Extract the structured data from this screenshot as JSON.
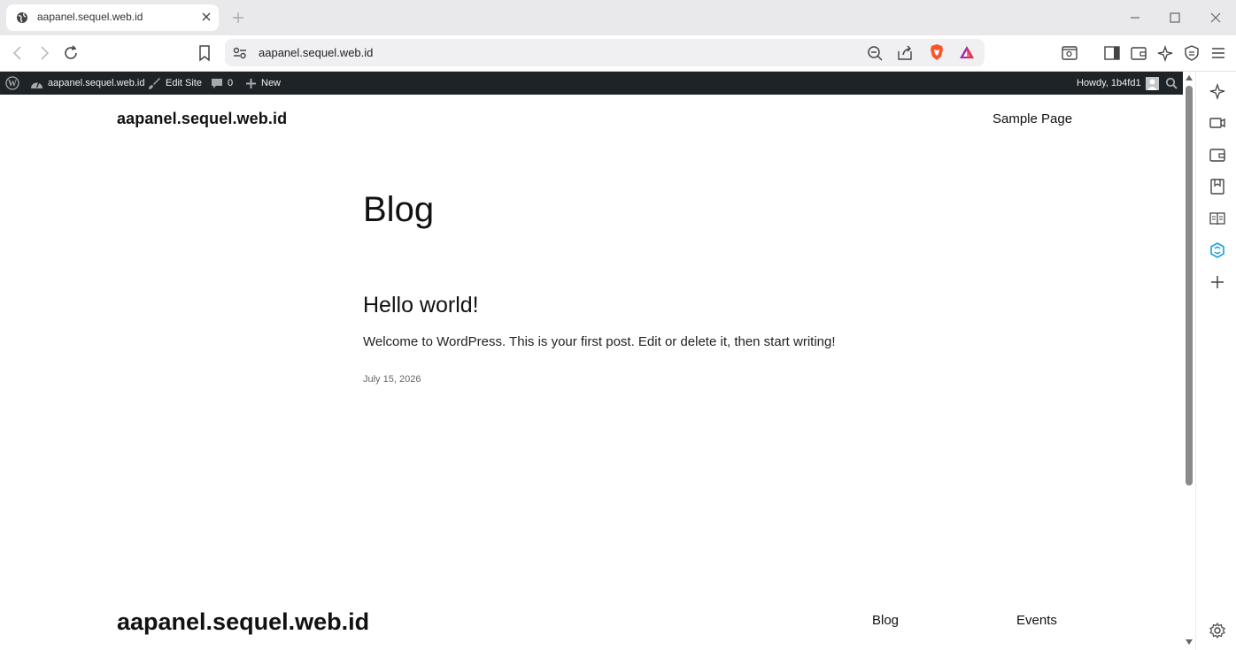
{
  "browser": {
    "tab_title": "aapanel.sequel.web.id",
    "url": "aapanel.sequel.web.id"
  },
  "admin_bar": {
    "site_name": "aapanel.sequel.web.id",
    "edit_site": "Edit Site",
    "comments_count": "0",
    "new_label": "New",
    "howdy": "Howdy, 1b4fd1"
  },
  "site": {
    "title": "aapanel.sequel.web.id",
    "nav_sample_page": "Sample Page"
  },
  "main": {
    "heading": "Blog",
    "post": {
      "title": "Hello world!",
      "excerpt": "Welcome to WordPress. This is your first post. Edit or delete it, then start writing!",
      "date": "July 15, 2026"
    }
  },
  "footer": {
    "title": "aapanel.sequel.web.id",
    "links": [
      "Blog",
      "Events"
    ]
  },
  "colors": {
    "admin_bar_bg": "#1d2327",
    "brave_orange": "#fb542b",
    "sidebar_accent": "#1a9fd9"
  }
}
